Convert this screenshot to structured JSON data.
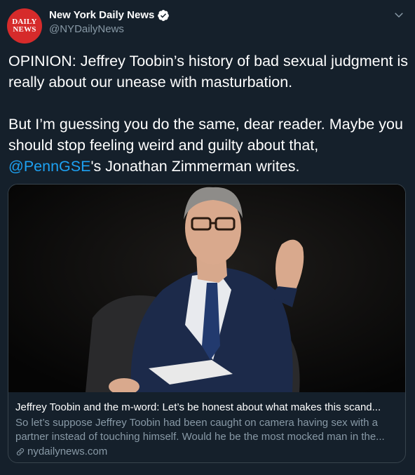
{
  "author": {
    "name": "New York Daily News",
    "handle": "@NYDailyNews",
    "avatar_line1": "DAILY",
    "avatar_line2": "NEWS",
    "verified": true
  },
  "tweet": {
    "line1": "OPINION: Jeffrey Toobin’s history of bad sexual judgment is really about our unease with masturbation.",
    "line2": "But I’m guessing you do the same, dear reader. Maybe you should stop feeling weird and guilty about that,",
    "mention": "@PennGSE",
    "line2_tail": "'s Jonathan Zimmerman writes."
  },
  "card": {
    "title": "Jeffrey Toobin and the m-word: Let’s be honest about what makes this scand...",
    "description": "So let’s suppose Jeffrey Toobin had been caught on camera having sex with a partner instead of touching himself. Would he be the most mocked man in the...",
    "domain": "nydailynews.com"
  },
  "colors": {
    "background": "#15202b",
    "accent": "#1da1f2",
    "muted": "#8899a6",
    "avatar_red": "#d62b2b"
  },
  "icons": [
    "verified-badge-icon",
    "chevron-down-icon",
    "link-icon"
  ]
}
